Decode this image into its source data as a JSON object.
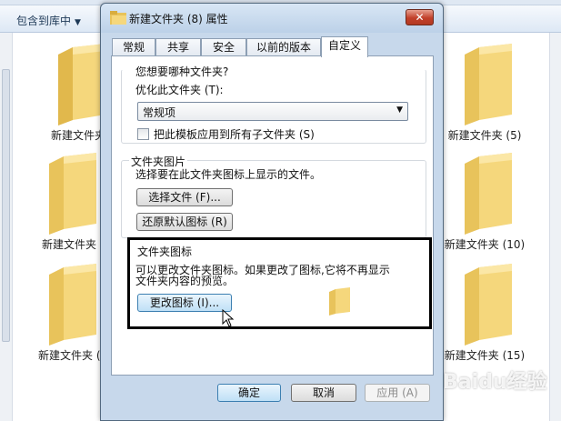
{
  "explorer": {
    "toolbar": {
      "include_library_label": "包含到库中"
    },
    "folders": [
      {
        "label": "新建文件夹"
      },
      {
        "label": "新建文件夹 (5)"
      },
      {
        "label": "新建文件夹"
      },
      {
        "label": "新建文件夹 (10)"
      },
      {
        "label": "新建文件夹 ("
      },
      {
        "label": "新建文件夹 (15)"
      }
    ]
  },
  "dialog": {
    "title": "新建文件夹 (8) 属性",
    "close_label": "✕",
    "tabs": [
      {
        "label": "常规"
      },
      {
        "label": "共享"
      },
      {
        "label": "安全"
      },
      {
        "label": "以前的版本"
      },
      {
        "label": "自定义",
        "active": true
      }
    ],
    "optimize_group": {
      "heading": "您想要哪种文件夹?",
      "optimize_label": "优化此文件夹 (T):",
      "selected_option": "常规项",
      "apply_subfolders_label": "把此模板应用到所有子文件夹 (S)",
      "apply_subfolders_checked": false
    },
    "picture_group": {
      "legend": "文件夹图片",
      "description": "选择要在此文件夹图标上显示的文件。",
      "choose_file_label": "选择文件 (F)...",
      "restore_default_label": "还原默认图标 (R)"
    },
    "icon_group": {
      "legend": "文件夹图标",
      "description_line1": "可以更改文件夹图标。如果更改了图标,它将不再显示",
      "description_line2": "文件夹内容的预览。",
      "change_icon_label": "更改图标 (I)..."
    },
    "buttons": {
      "ok": "确定",
      "cancel": "取消",
      "apply": "应用 (A)"
    }
  },
  "watermark": "Baidu经验",
  "colors": {
    "accent": "#3c7fb1",
    "close_red": "#c2402a",
    "folder_yellow": "#f2cf6b"
  }
}
